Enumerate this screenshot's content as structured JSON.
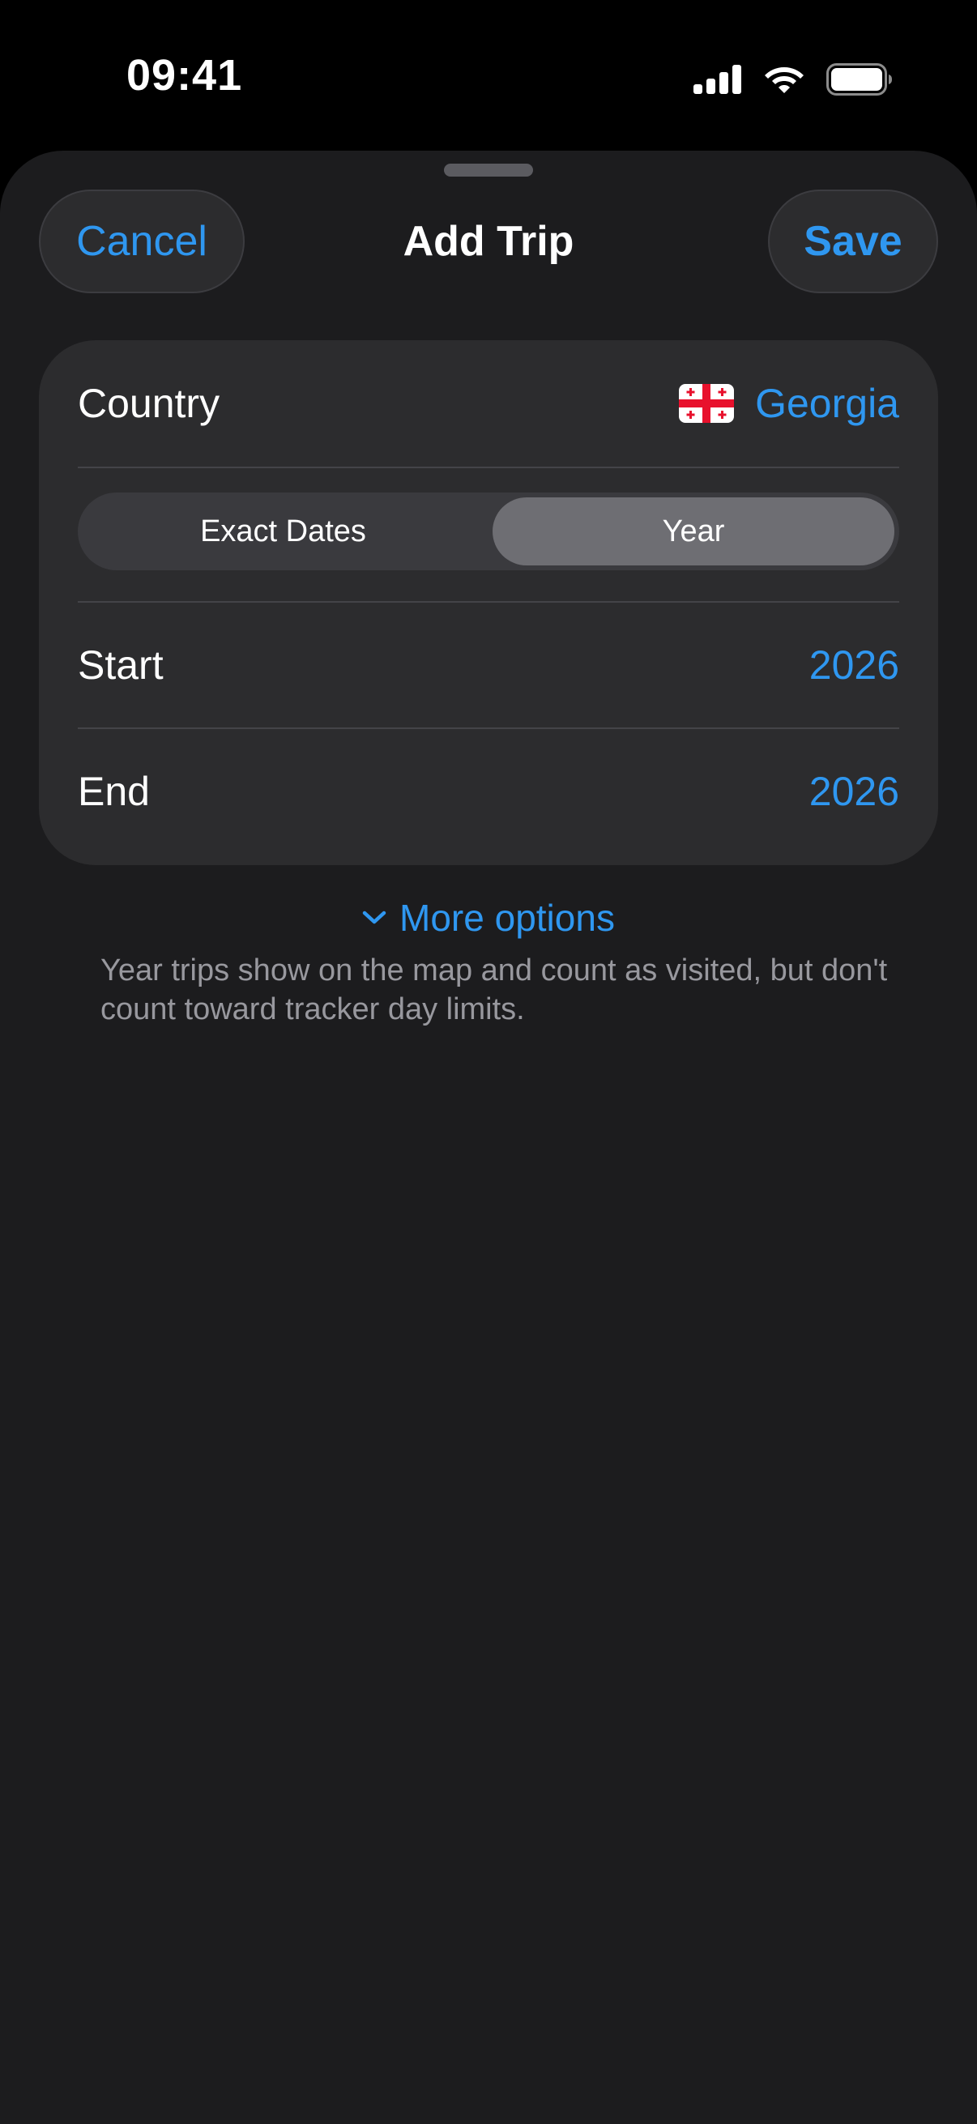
{
  "status_bar": {
    "time": "09:41",
    "icons": [
      "cellular-signal-icon",
      "wifi-icon",
      "battery-icon"
    ]
  },
  "sheet": {
    "title": "Add Trip",
    "cancel_label": "Cancel",
    "save_label": "Save"
  },
  "form": {
    "country": {
      "label": "Country",
      "value": "Georgia",
      "flag_icon": "georgia-flag-icon"
    },
    "date_mode": {
      "options": [
        "Exact Dates",
        "Year"
      ],
      "selected": "Year"
    },
    "start": {
      "label": "Start",
      "value": "2026"
    },
    "end": {
      "label": "End",
      "value": "2026"
    }
  },
  "more_options": {
    "label": "More options",
    "icon": "chevron-down-icon"
  },
  "footnote": "Year trips show on the map and count as visited, but don't count toward tracker day limits.",
  "colors": {
    "accent": "#2f97f0",
    "sheet_background": "#1c1c1e",
    "card_background": "#2c2c2e",
    "segment_selected": "#6e6e73",
    "secondary_text": "#98989e"
  }
}
